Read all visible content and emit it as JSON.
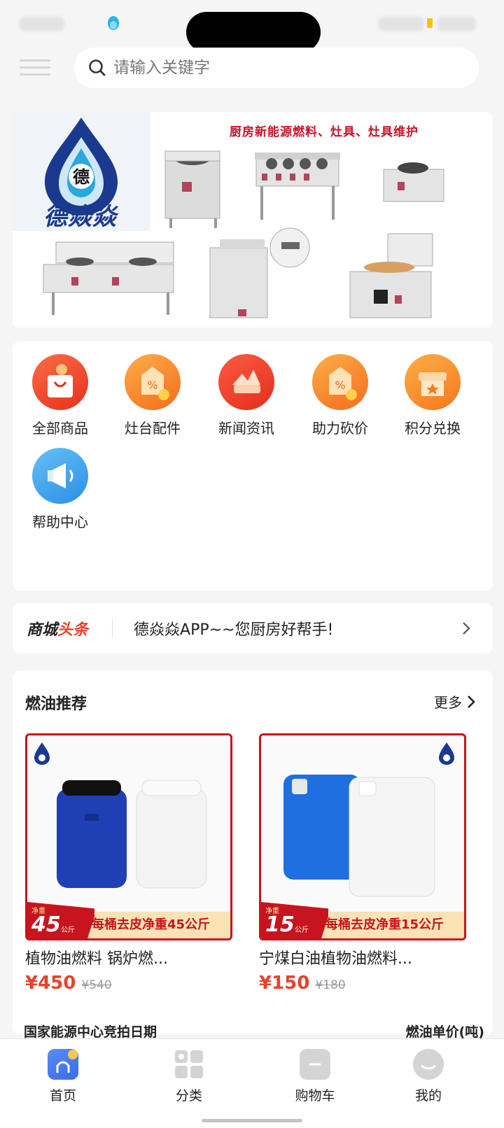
{
  "search": {
    "placeholder": "请输入关键字"
  },
  "banner": {
    "title": "厨房新能源燃料、灶具、灶具维护",
    "logo_char": "德",
    "logo_text": "德焱焱"
  },
  "categories": [
    {
      "label": "全部商品",
      "icon": "shopping-bag-icon",
      "color": "#f0522d"
    },
    {
      "label": "灶台配件",
      "icon": "price-tag-icon",
      "color": "#f5962a"
    },
    {
      "label": "新闻资讯",
      "icon": "news-icon",
      "color": "#f0522d"
    },
    {
      "label": "助力砍价",
      "icon": "bargain-tag-icon",
      "color": "#f5962a"
    },
    {
      "label": "积分兑换",
      "icon": "points-store-icon",
      "color": "#f5962a"
    },
    {
      "label": "帮助中心",
      "icon": "megaphone-icon",
      "color": "#3a9ff0"
    }
  ],
  "headline": {
    "brand_part1": "商城",
    "brand_part2": "头条",
    "text": "德焱焱APP~~您厨房好帮手!"
  },
  "recommend": {
    "title": "燃油推荐",
    "more": "更多",
    "products": [
      {
        "name": "植物油燃料 锅炉燃...",
        "price": "¥450",
        "old_price": "¥540",
        "badge_net": "净重",
        "badge_num": "45",
        "badge_unit": "公斤",
        "slogan": "每桶去皮净重45公斤",
        "logo_text": "德焱焱"
      },
      {
        "name": "宁煤白油植物油燃料...",
        "price": "¥150",
        "old_price": "¥180",
        "badge_net": "净重",
        "badge_num": "15",
        "badge_unit": "公斤",
        "slogan": "每桶去皮净重15公斤",
        "logo_text": "德焱焱"
      }
    ]
  },
  "energy": {
    "left": "国家能源中心竞拍日期",
    "right": "燃油单价(吨)"
  },
  "tabbar": [
    {
      "label": "首页",
      "icon": "home-icon",
      "active": true
    },
    {
      "label": "分类",
      "icon": "category-icon",
      "active": false
    },
    {
      "label": "购物车",
      "icon": "cart-icon",
      "active": false
    },
    {
      "label": "我的",
      "icon": "profile-icon",
      "active": false
    }
  ]
}
